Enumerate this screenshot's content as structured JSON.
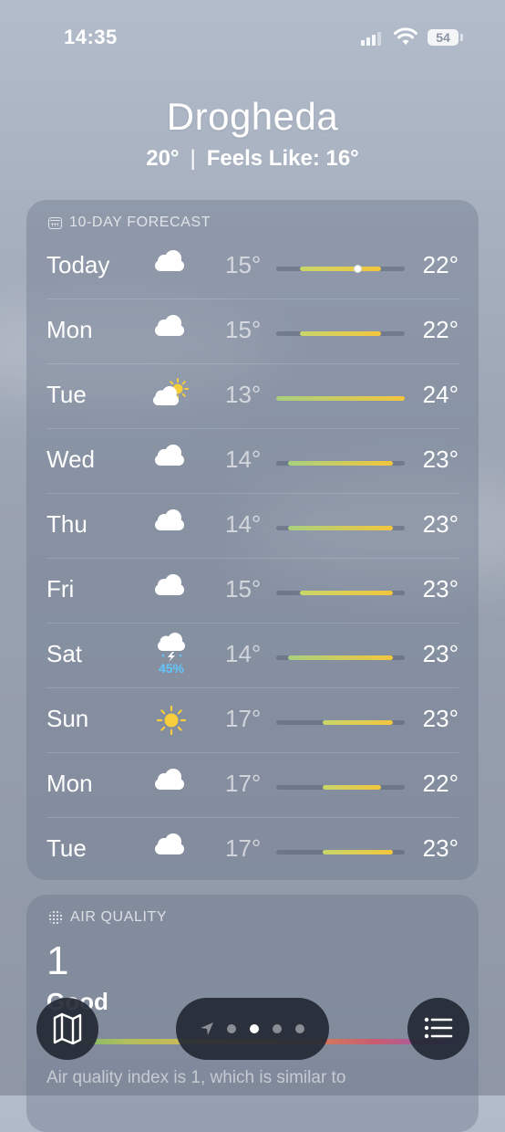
{
  "status_bar": {
    "time": "14:35",
    "battery": "54"
  },
  "header": {
    "city": "Drogheda",
    "current_temp": "20°",
    "feels_like": "Feels Like: 16°"
  },
  "forecast": {
    "title": "10-DAY FORECAST",
    "days": [
      {
        "day": "Today",
        "icon": "cloud-icon",
        "low": "15°",
        "high": "22°",
        "range": [
          15,
          22
        ],
        "current": 20
      },
      {
        "day": "Mon",
        "icon": "cloud-icon",
        "low": "15°",
        "high": "22°",
        "range": [
          15,
          22
        ]
      },
      {
        "day": "Tue",
        "icon": "partly-sunny-icon",
        "low": "13°",
        "high": "24°",
        "range": [
          13,
          24
        ]
      },
      {
        "day": "Wed",
        "icon": "cloud-icon",
        "low": "14°",
        "high": "23°",
        "range": [
          14,
          23
        ]
      },
      {
        "day": "Thu",
        "icon": "cloud-icon",
        "low": "14°",
        "high": "23°",
        "range": [
          14,
          23
        ]
      },
      {
        "day": "Fri",
        "icon": "cloud-icon",
        "low": "15°",
        "high": "23°",
        "range": [
          15,
          23
        ]
      },
      {
        "day": "Sat",
        "icon": "thunderstorm-icon",
        "precip": "45%",
        "low": "14°",
        "high": "23°",
        "range": [
          14,
          23
        ]
      },
      {
        "day": "Sun",
        "icon": "sun-icon",
        "low": "17°",
        "high": "23°",
        "range": [
          17,
          23
        ]
      },
      {
        "day": "Mon",
        "icon": "cloud-icon",
        "low": "17°",
        "high": "22°",
        "range": [
          17,
          22
        ]
      },
      {
        "day": "Tue",
        "icon": "cloud-icon",
        "low": "17°",
        "high": "23°",
        "range": [
          17,
          23
        ]
      }
    ],
    "scale": [
      13,
      24
    ],
    "colors": {
      "cool": "#a8d17f",
      "warm": "#f4c63c",
      "track": "#5a6577"
    }
  },
  "air_quality": {
    "title": "AIR QUALITY",
    "value": "1",
    "category": "Good",
    "description": "Air quality index is 1, which is similar to"
  },
  "bottom_bar": {
    "page_count": 4,
    "active_page": 1
  }
}
